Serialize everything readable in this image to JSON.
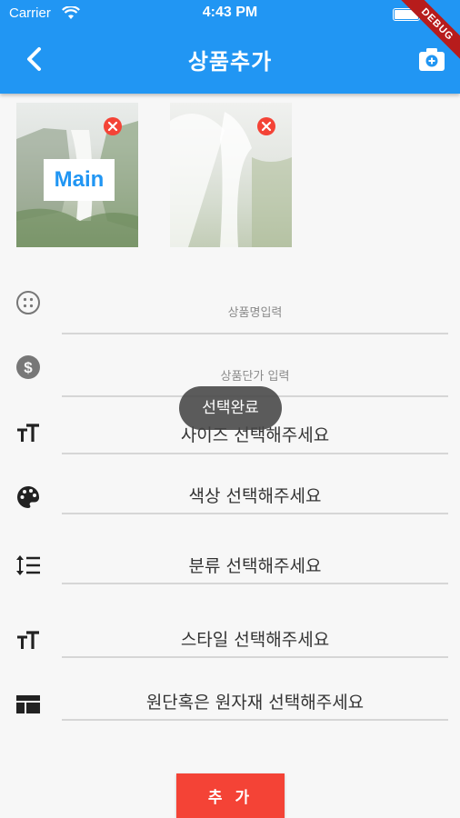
{
  "status_bar": {
    "carrier": "Carrier",
    "time": "4:43 PM"
  },
  "app_bar": {
    "title": "상품추가",
    "debug_label": "DEBUG",
    "color": "#2196f3",
    "icons": {
      "back": "back-chevron-icon",
      "camera": "add-photo-camera-icon"
    }
  },
  "images": {
    "main_label": "Main",
    "items": [
      {
        "description_icon": "waterfall-landscape",
        "is_main": true
      },
      {
        "description_icon": "waterfall-closeup",
        "is_main": false
      }
    ],
    "remove_icon": "remove-circle-icon"
  },
  "form": {
    "product_name_placeholder": "상품명입력",
    "price_placeholder": "상품단가 입력",
    "size_label": "사이즈 선택해주세요",
    "color_label": "색상 선택해주세요",
    "category_label": "분류 선택해주세요",
    "style_label": "스타일 선택해주세요",
    "material_label": "원단혹은 원자재 선택해주세요",
    "icons": [
      "radio-button-icon",
      "dollar-circle-icon",
      "text-size-icon",
      "palette-icon",
      "line-spacing-icon",
      "text-size-icon",
      "table-layout-icon"
    ]
  },
  "actions": {
    "add_label": "추 가",
    "add_color": "#f44336"
  },
  "toast": {
    "message": "선택완료"
  }
}
